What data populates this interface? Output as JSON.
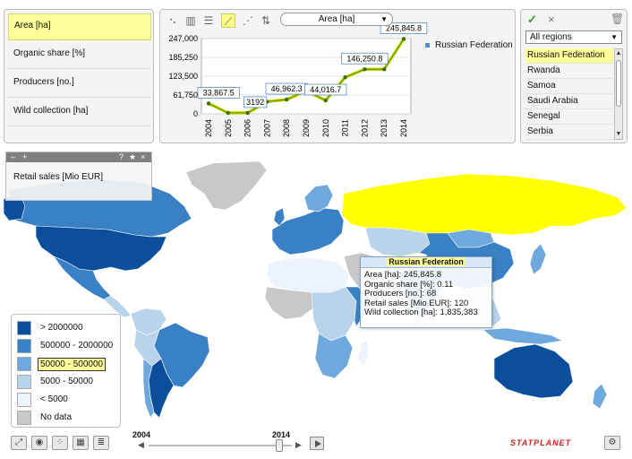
{
  "indicators": [
    {
      "label": "Area [ha]",
      "active": true
    },
    {
      "label": "Organic share [%]",
      "active": false
    },
    {
      "label": "Producers [no.]",
      "active": false
    },
    {
      "label": "Wild collection [ha]",
      "active": false
    }
  ],
  "chart_toolbar": {
    "icons": [
      "scatter-icon",
      "bar-chart-icon",
      "horizontal-bar-icon",
      "line-chart-icon",
      "scatter-line-icon",
      "sort-icon"
    ],
    "active_icon": "line-chart-icon",
    "indicator_select": "Area [ha]"
  },
  "chart_data": {
    "type": "line",
    "x": [
      "2004",
      "2005",
      "2006",
      "2007",
      "2008",
      "2009",
      "2010",
      "2011",
      "2012",
      "2013",
      "2014"
    ],
    "series": [
      {
        "name": "Russian Federation",
        "values": [
          33867.5,
          3192,
          3192,
          40000,
          46962.3,
          75000,
          44016.7,
          120000,
          146250.8,
          146250.8,
          245845.8
        ],
        "labels": [
          "33,867.5",
          "",
          "3192",
          "",
          "46,962.3",
          "",
          "44,016.7",
          "",
          "146,250.8",
          "",
          "245,845.8"
        ],
        "color": "#9acd32"
      }
    ],
    "ylim": [
      0,
      247000
    ],
    "y_ticks": [
      "247,000",
      "185,250",
      "123,500",
      "61,750",
      "0"
    ],
    "y_tick_values": [
      247000,
      185250,
      123500,
      61750,
      0
    ],
    "grid": true,
    "legend": "right"
  },
  "regions": {
    "filter": "All regions",
    "items": [
      "Russian Federation",
      "Rwanda",
      "Samoa",
      "Saudi Arabia",
      "Senegal",
      "Serbia"
    ],
    "selected": "Russian Federation"
  },
  "retail_panel": {
    "minimize": "–",
    "add": "+",
    "help": "?",
    "pin": "★",
    "close": "×",
    "label": "Retail sales [Mio EUR]"
  },
  "tooltip": {
    "title": "Russian Federation",
    "lines": [
      "Area [ha]: 245,845.8",
      "Organic share [%]: 0.11",
      "Producers [no.]: 68",
      "Retail sales [Mio EUR]: 120",
      "Wild collection [ha]: 1,835,383"
    ]
  },
  "map_legend": {
    "items": [
      {
        "label": "> 2000000",
        "color": "#0b4f9c"
      },
      {
        "label": "500000 - 2000000",
        "color": "#3a80c4"
      },
      {
        "label": "50000 - 500000",
        "color": "#6fa8dc",
        "active": true
      },
      {
        "label": "5000 - 50000",
        "color": "#b9d3ea"
      },
      {
        "label": "< 5000",
        "color": "#edf3fa"
      },
      {
        "label": "No data",
        "color": "#c8c8c8"
      }
    ]
  },
  "timeline": {
    "start": "2004",
    "end": "2014",
    "position": 1.0
  },
  "brand": "STATPLANET",
  "colors": {
    "highlight": "#ffff00",
    "dark": "#0b4f9c",
    "mid": "#3a80c4",
    "light_mid": "#6fa8dc",
    "light": "#b9d3ea",
    "very_light": "#edf3fa",
    "nodata": "#c8c8c8"
  }
}
